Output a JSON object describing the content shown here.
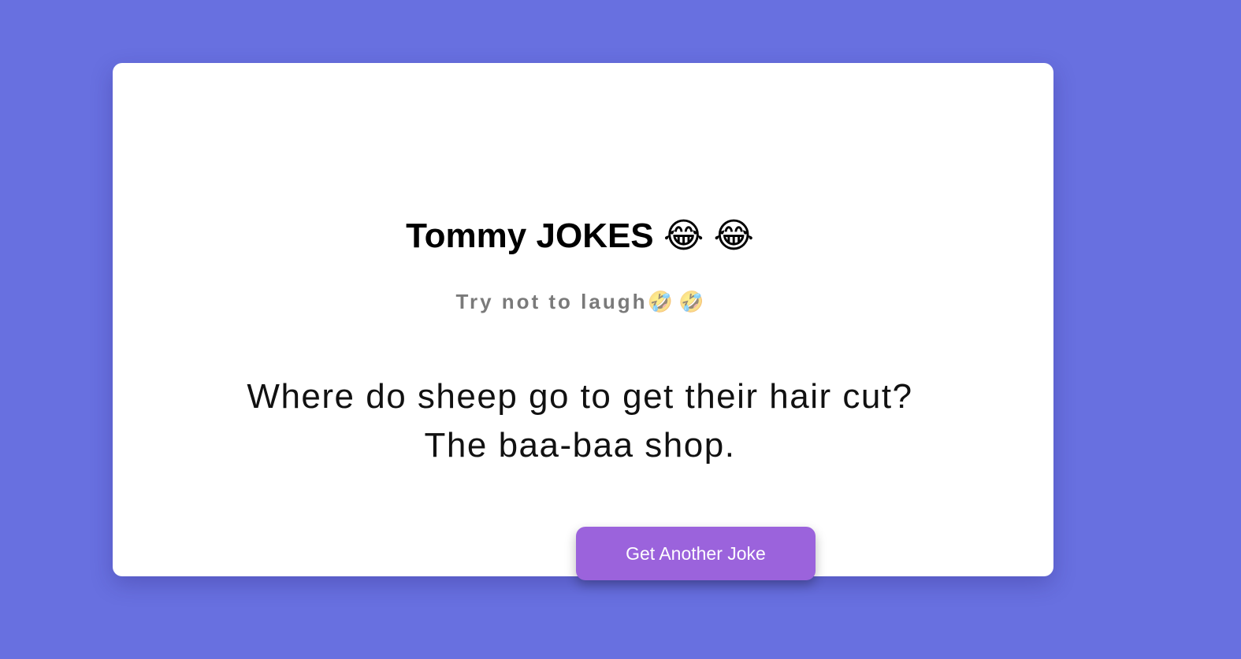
{
  "header": {
    "title": "Tommy JOKES 😂 😂",
    "tagline_text": "Try not to laugh",
    "tagline_emoji": "🤣 🤣"
  },
  "joke": {
    "text": "Where do sheep go to get their hair cut?\nThe baa-baa shop."
  },
  "actions": {
    "get_joke_label": "Get Another Joke"
  },
  "colors": {
    "background": "#6870e0",
    "card": "#ffffff",
    "button": "#9b63dc",
    "tagline": "#7a7a7a"
  }
}
